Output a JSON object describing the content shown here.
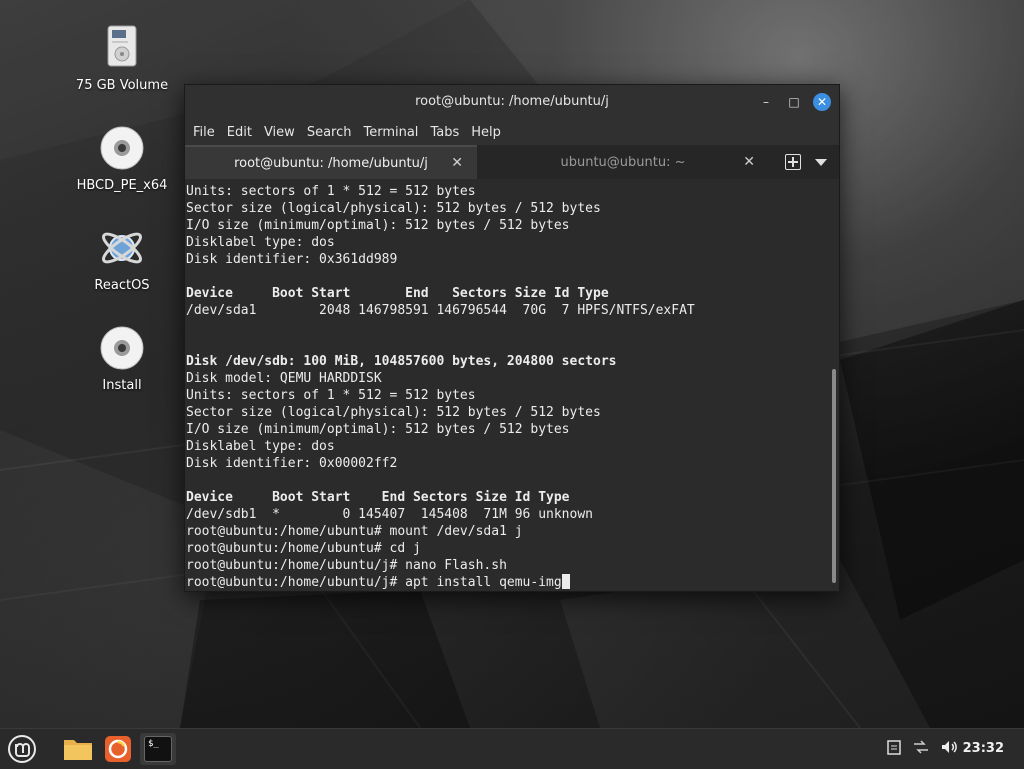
{
  "desktop": {
    "icons": [
      {
        "label": "75 GB Volume",
        "icon": "drive-icon"
      },
      {
        "label": "HBCD_PE_x64",
        "icon": "cd-disc-icon"
      },
      {
        "label": "ReactOS",
        "icon": "reactos-icon"
      },
      {
        "label": "Install",
        "icon": "cd-disc-icon"
      }
    ]
  },
  "window": {
    "title": "root@ubuntu: /home/ubuntu/j",
    "controls": {
      "minimize": "–",
      "maximize": "□",
      "close": "✕"
    },
    "menu": [
      "File",
      "Edit",
      "View",
      "Search",
      "Terminal",
      "Tabs",
      "Help"
    ],
    "tabs": [
      {
        "label": "root@ubuntu: /home/ubuntu/j",
        "active": true,
        "close": "✕"
      },
      {
        "label": "ubuntu@ubuntu: ~",
        "active": false,
        "close": "✕"
      }
    ]
  },
  "terminal": {
    "lines": [
      {
        "text": "Units: sectors of 1 * 512 = 512 bytes",
        "bold": false
      },
      {
        "text": "Sector size (logical/physical): 512 bytes / 512 bytes",
        "bold": false
      },
      {
        "text": "I/O size (minimum/optimal): 512 bytes / 512 bytes",
        "bold": false
      },
      {
        "text": "Disklabel type: dos",
        "bold": false
      },
      {
        "text": "Disk identifier: 0x361dd989",
        "bold": false
      },
      {
        "text": "",
        "bold": false
      },
      {
        "text": "Device     Boot Start       End   Sectors Size Id Type",
        "bold": true
      },
      {
        "text": "/dev/sda1        2048 146798591 146796544  70G  7 HPFS/NTFS/exFAT",
        "bold": false
      },
      {
        "text": "",
        "bold": false
      },
      {
        "text": "",
        "bold": false
      },
      {
        "text": "Disk /dev/sdb: 100 MiB, 104857600 bytes, 204800 sectors",
        "bold": true
      },
      {
        "text": "Disk model: QEMU HARDDISK",
        "bold": false
      },
      {
        "text": "Units: sectors of 1 * 512 = 512 bytes",
        "bold": false
      },
      {
        "text": "Sector size (logical/physical): 512 bytes / 512 bytes",
        "bold": false
      },
      {
        "text": "I/O size (minimum/optimal): 512 bytes / 512 bytes",
        "bold": false
      },
      {
        "text": "Disklabel type: dos",
        "bold": false
      },
      {
        "text": "Disk identifier: 0x00002ff2",
        "bold": false
      },
      {
        "text": "",
        "bold": false
      },
      {
        "text": "Device     Boot Start    End Sectors Size Id Type",
        "bold": true
      },
      {
        "text": "/dev/sdb1  *        0 145407  145408  71M 96 unknown",
        "bold": false
      },
      {
        "text": "root@ubuntu:/home/ubuntu# mount /dev/sda1 j",
        "bold": false
      },
      {
        "text": "root@ubuntu:/home/ubuntu# cd j",
        "bold": false
      },
      {
        "text": "root@ubuntu:/home/ubuntu/j# nano Flash.sh",
        "bold": false
      }
    ],
    "prompt_line": "root@ubuntu:/home/ubuntu/j# apt install qemu-img"
  },
  "panel": {
    "menu_icon": "linux-mint-logo-icon",
    "launchers": [
      {
        "name": "files",
        "icon": "folder-icon"
      },
      {
        "name": "firefox",
        "icon": "firefox-icon"
      },
      {
        "name": "terminal",
        "icon": "terminal-icon",
        "glyph": "$_"
      }
    ],
    "tray": [
      "clipboard-icon",
      "network-icon",
      "volume-icon"
    ],
    "clock": "23:32"
  },
  "colors": {
    "accent": "#3b8ee0",
    "terminal_bg": "#2b2b2b",
    "panel_bg": "#2a2a2a"
  }
}
